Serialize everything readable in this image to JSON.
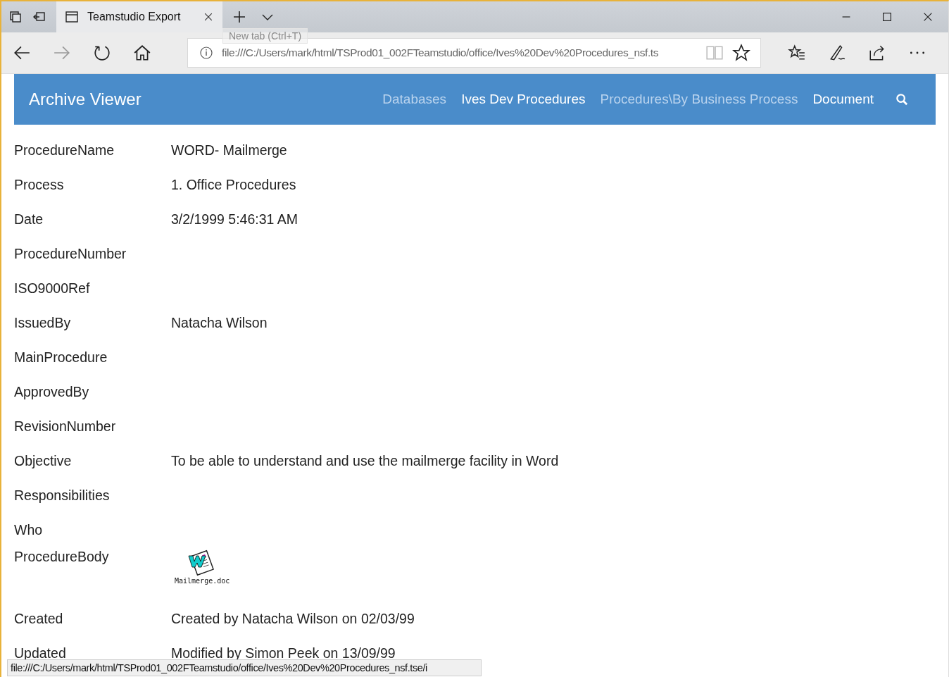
{
  "browser": {
    "tab_title": "Teamstudio Export",
    "tooltip": "New tab (Ctrl+T)",
    "address": "file:///C:/Users/mark/html/TSProd01_002FTeamstudio/office/Ives%20Dev%20Procedures_nsf.ts",
    "status_url": "file:///C:/Users/mark/html/TSProd01_002FTeamstudio/office/Ives%20Dev%20Procedures_nsf.tse/i"
  },
  "header": {
    "title": "Archive Viewer",
    "links": [
      {
        "label": "Databases",
        "muted": true
      },
      {
        "label": "Ives Dev Procedures",
        "muted": false
      },
      {
        "label": "Procedures\\By Business Process",
        "muted": true
      },
      {
        "label": "Document",
        "muted": false
      }
    ]
  },
  "fields": [
    {
      "kind": "text",
      "label": "ProcedureName",
      "value": "WORD- Mailmerge"
    },
    {
      "kind": "text",
      "label": "Process",
      "value": "1. Office Procedures"
    },
    {
      "kind": "text",
      "label": "Date",
      "value": "3/2/1999 5:46:31 AM"
    },
    {
      "kind": "text",
      "label": "ProcedureNumber"
    },
    {
      "kind": "text",
      "label": "ISO9000Ref"
    },
    {
      "kind": "text",
      "label": "IssuedBy",
      "value": "Natacha Wilson"
    },
    {
      "kind": "text",
      "label": "MainProcedure"
    },
    {
      "kind": "text",
      "label": "ApprovedBy"
    },
    {
      "kind": "text",
      "label": "RevisionNumber"
    },
    {
      "kind": "text",
      "label": "Objective",
      "value": "To be able to understand and use the mailmerge facility in Word"
    },
    {
      "kind": "text",
      "label": "Responsibilities"
    },
    {
      "kind": "text",
      "label": "Who"
    },
    {
      "kind": "attachment",
      "label": "ProcedureBody",
      "value": "Mailmerge.doc"
    },
    {
      "kind": "text",
      "label": "Created",
      "value": "Created by Natacha Wilson on 02/03/99"
    },
    {
      "kind": "text",
      "label": "Updated",
      "value": "Modified by Simon Peek on 13/09/99"
    }
  ]
}
